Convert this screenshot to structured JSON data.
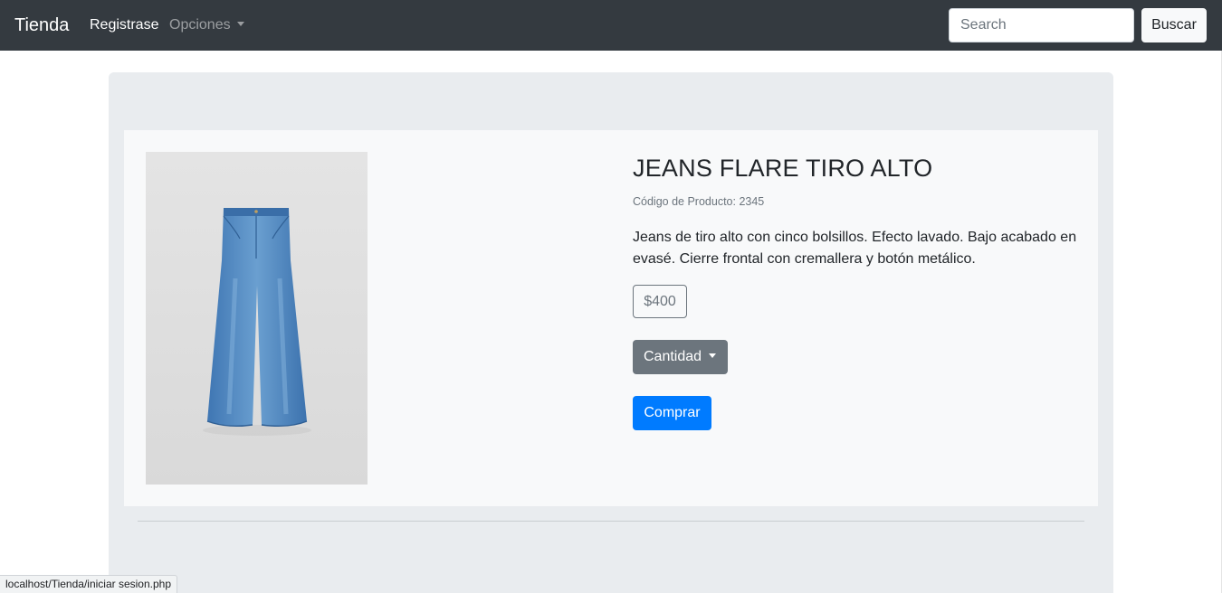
{
  "navbar": {
    "brand": "Tienda",
    "links": {
      "register": "Registrase",
      "options": "Opciones"
    },
    "search": {
      "placeholder": "Search",
      "button_label": "Buscar"
    }
  },
  "product": {
    "title": "JEANS FLARE TIRO ALTO",
    "code": "Código de Producto: 2345",
    "description": "Jeans de tiro alto con cinco bolsillos. Efecto lavado. Bajo acabado en evasé. Cierre frontal con cremallera y botón metálico.",
    "price": "$400",
    "quantity_label": "Cantidad",
    "buy_label": "Comprar",
    "image_alt": "Jeans flare tiro alto"
  },
  "status_bar": {
    "url": "localhost/Tienda/iniciar sesion.php"
  },
  "colors": {
    "navbar": "#343a40",
    "primary": "#007bff",
    "secondary": "#6c757d",
    "jumbotron": "#e9ecef"
  }
}
